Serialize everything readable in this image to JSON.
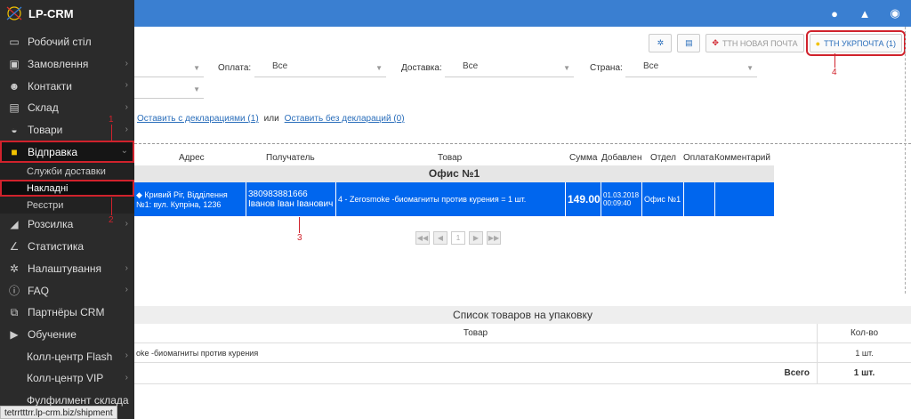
{
  "app": {
    "logo_text": "LP-CRM"
  },
  "sidebar": {
    "items": [
      {
        "label": "Робочий стіл",
        "icon": "monitor-icon",
        "glyph": "▭"
      },
      {
        "label": "Замовлення",
        "icon": "money-icon",
        "glyph": "▣"
      },
      {
        "label": "Контакти",
        "icon": "users-icon",
        "glyph": "☻"
      },
      {
        "label": "Склад",
        "icon": "archive-icon",
        "glyph": "▤"
      },
      {
        "label": "Товари",
        "icon": "inbox-icon",
        "glyph": "◒"
      },
      {
        "label": "Відправка",
        "icon": "truck-icon",
        "glyph": "■"
      }
    ],
    "subitems": [
      {
        "label": "Служби доставки"
      },
      {
        "label": "Накладні"
      },
      {
        "label": "Реєстри"
      }
    ],
    "items2": [
      {
        "label": "Розсилка",
        "icon": "bullhorn-icon",
        "glyph": "◢"
      },
      {
        "label": "Статистика",
        "icon": "chart-icon",
        "glyph": "∠"
      },
      {
        "label": "Налаштування",
        "icon": "gear-icon",
        "glyph": "✲"
      },
      {
        "label": "FAQ",
        "icon": "info-icon",
        "glyph": "ⓘ"
      },
      {
        "label": "Партнёры CRM",
        "icon": "handshake-icon",
        "glyph": "⧉"
      },
      {
        "label": "Обучение",
        "icon": "video-icon",
        "glyph": "▶"
      },
      {
        "label": "Колл-центр Flash",
        "icon": "",
        "glyph": ""
      },
      {
        "label": "Колл-центр VIP",
        "icon": "",
        "glyph": ""
      },
      {
        "label": "Фулфилмент склада",
        "icon": "",
        "glyph": ""
      }
    ]
  },
  "status_url": "tetrrtttrr.lp-crm.biz/shipment",
  "toolbar": {
    "np_label": "ТТН НОВАЯ ПОЧТА",
    "ukr_label": "ТТН УКРПОЧТА (1)"
  },
  "filters": {
    "payment_label": "Оплата:",
    "payment_value": "Все",
    "delivery_label": "Доставка:",
    "delivery_value": "Все",
    "country_label": "Страна:",
    "country_value": "Все"
  },
  "links": {
    "with_decl": "Оставить с декларациями (1)",
    "or": "или",
    "without_decl": "Оставить без деклараций (0)"
  },
  "table": {
    "headers": {
      "address": "Адрес",
      "recipient": "Получатель",
      "product": "Товар",
      "sum": "Сумма",
      "added": "Добавлен",
      "dept": "Отдел",
      "payment": "Оплата",
      "comment": "Комментарий"
    },
    "group": "Офис №1",
    "row": {
      "address1": "Кривий Ріг, Відділення",
      "address2": "№1: вул. Купріна, 1236",
      "phone": "380983881666",
      "name": "Іванов Іван Іванович",
      "product": "4 - Zerosmoke -биомагниты против курения = 1 шт.",
      "sum": "149.00",
      "date": "01.03.2018",
      "time": "00:09:40",
      "dept": "Офис №1"
    }
  },
  "pager": {
    "page": "1"
  },
  "pack": {
    "title": "Список товаров на упаковку",
    "col_product": "Товар",
    "col_qty": "Кол-во",
    "item": "oke -биомагниты против курения",
    "item_qty": "1 шт.",
    "total_label": "Всего",
    "total_qty": "1 шт."
  },
  "annotations": {
    "a1": "1",
    "a2": "2",
    "a3": "3",
    "a4": "4"
  }
}
